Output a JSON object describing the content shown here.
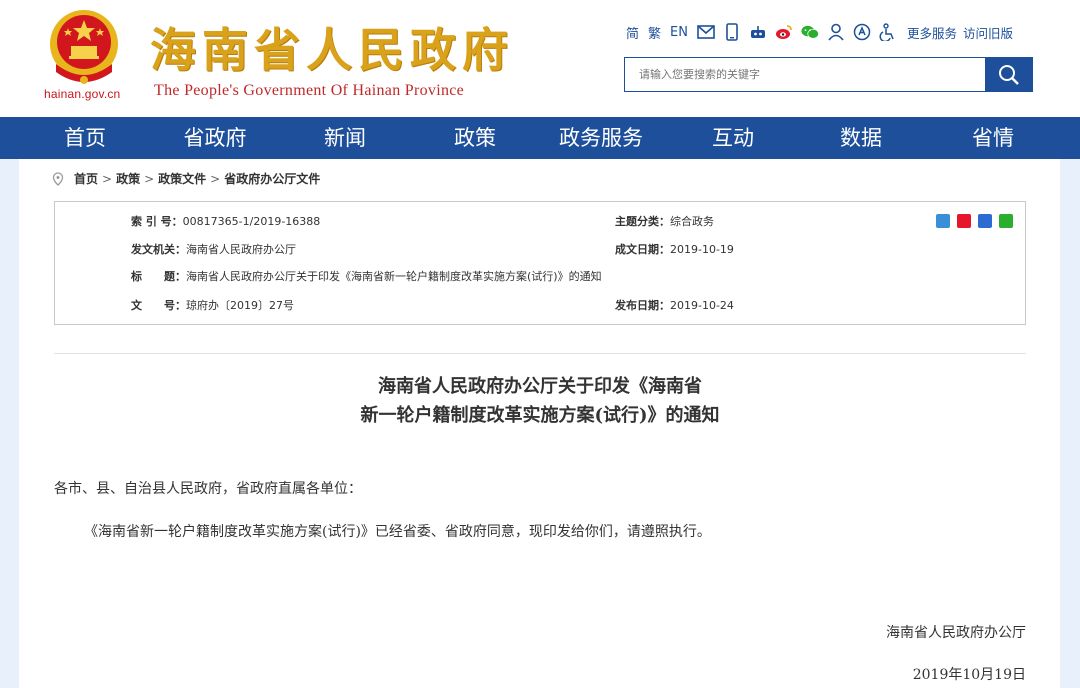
{
  "header": {
    "site_title": "海南省人民政府",
    "site_title_en": "The People's Government Of Hainan Province",
    "domain": "hainan.gov.cn",
    "toolbar": {
      "simplified": "简",
      "traditional": "繁",
      "english": "EN",
      "more_services": "更多服务",
      "visit_old": "访问旧版"
    },
    "search_placeholder": "请输入您要搜索的关键字"
  },
  "nav": {
    "items": [
      "首页",
      "省政府",
      "新闻",
      "政策",
      "政务服务",
      "互动",
      "数据",
      "省情"
    ]
  },
  "breadcrumb": {
    "items": [
      "首页",
      "政策",
      "政策文件",
      "省政府办公厅文件"
    ],
    "separator": ">"
  },
  "meta": {
    "index_label": "索 引 号：",
    "index_value": "00817365-1/2019-16388",
    "category_label": "主题分类：",
    "category_value": "综合政务",
    "issuer_label": "发文机关：",
    "issuer_value": "海南省人民政府办公厅",
    "created_label": "成文日期：",
    "created_value": "2019-10-19",
    "title_label": "标　　题：",
    "title_value": "海南省人民政府办公厅关于印发《海南省新一轮户籍制度改革实施方案(试行)》的通知",
    "docno_label": "文　　号：",
    "docno_value": "琼府办〔2019〕27号",
    "published_label": "发布日期：",
    "published_value": "2019-10-24"
  },
  "article": {
    "title_line1": "海南省人民政府办公厅关于印发《海南省",
    "title_line2": "新一轮户籍制度改革实施方案(试行)》的通知",
    "salutation": "各市、县、自治县人民政府，省政府直属各单位：",
    "body": "《海南省新一轮户籍制度改革实施方案(试行)》已经省委、省政府同意，现印发给你们，请遵照执行。",
    "signature": "海南省人民政府办公厅",
    "date": "2019年10月19日"
  },
  "colors": {
    "nav_blue": "#1d4f9b",
    "title_gold": "#d9a21a",
    "emblem_red": "#c8161d"
  }
}
